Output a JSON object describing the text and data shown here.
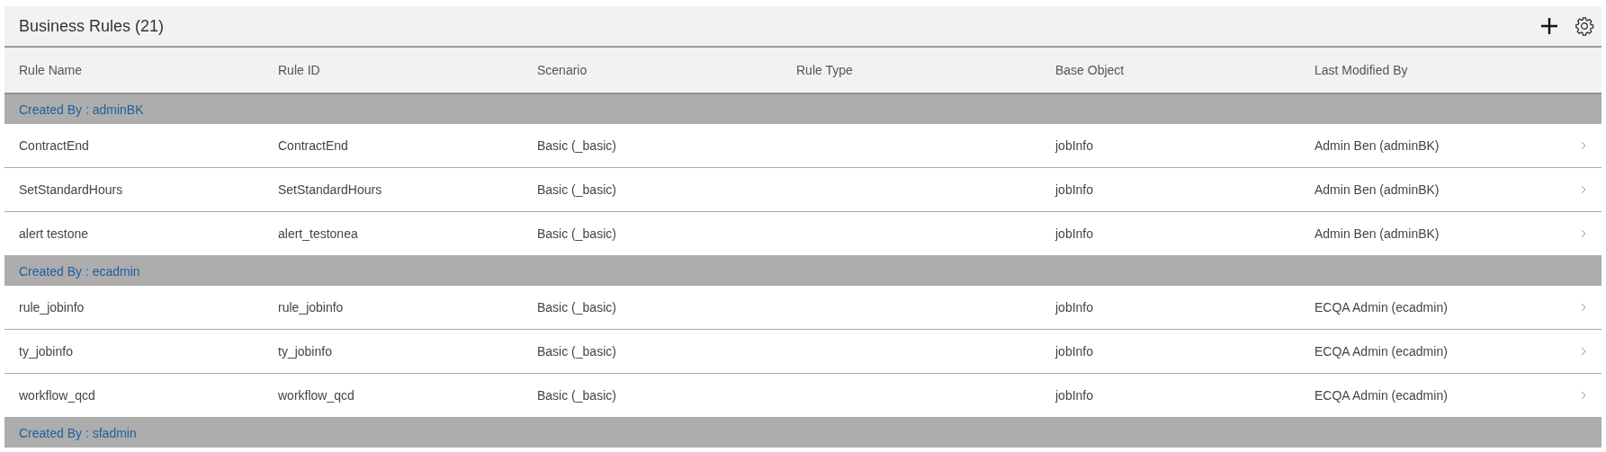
{
  "panel": {
    "title": "Business Rules (21)"
  },
  "table": {
    "columns": [
      "Rule Name",
      "Rule ID",
      "Scenario",
      "Rule Type",
      "Base Object",
      "Last Modified By"
    ],
    "groups": [
      {
        "label": "Created By : adminBK",
        "rows": [
          {
            "cells": [
              "ContractEnd",
              "ContractEnd",
              "Basic (_basic)",
              "",
              "jobInfo",
              "Admin Ben (adminBK)"
            ]
          },
          {
            "cells": [
              "SetStandardHours",
              "SetStandardHours",
              "Basic (_basic)",
              "",
              "jobInfo",
              "Admin Ben (adminBK)"
            ]
          },
          {
            "cells": [
              "alert testone",
              "alert_testonea",
              "Basic (_basic)",
              "",
              "jobInfo",
              "Admin Ben (adminBK)"
            ]
          }
        ]
      },
      {
        "label": "Created By : ecadmin",
        "rows": [
          {
            "cells": [
              "rule_jobinfo",
              "rule_jobinfo",
              "Basic (_basic)",
              "",
              "jobInfo",
              "ECQA Admin (ecadmin)"
            ]
          },
          {
            "cells": [
              "ty_jobinfo",
              "ty_jobinfo",
              "Basic (_basic)",
              "",
              "jobInfo",
              "ECQA Admin (ecadmin)"
            ]
          },
          {
            "cells": [
              "workflow_qcd",
              "workflow_qcd",
              "Basic (_basic)",
              "",
              "jobInfo",
              "ECQA Admin (ecadmin)"
            ]
          }
        ]
      },
      {
        "label": "Created By : sfadmin"
      }
    ]
  }
}
